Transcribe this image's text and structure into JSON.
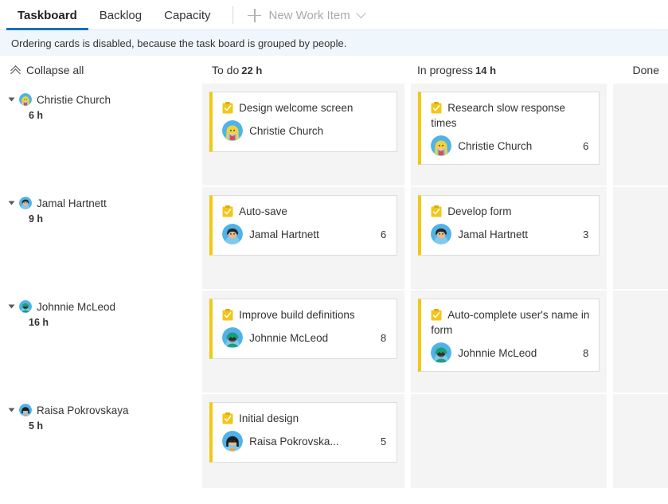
{
  "tabs": [
    {
      "label": "Taskboard",
      "active": true
    },
    {
      "label": "Backlog",
      "active": false
    },
    {
      "label": "Capacity",
      "active": false
    }
  ],
  "toolbar": {
    "new_work_item_label": "New Work Item",
    "plus_icon": "plus-icon",
    "chevron_icon": "chevron-down-icon"
  },
  "banner": {
    "message": "Ordering cards is disabled, because the task board is grouped by people."
  },
  "board": {
    "collapse_all_label": "Collapse all",
    "columns": [
      {
        "name": "To do",
        "hours": "22 h"
      },
      {
        "name": "In progress",
        "hours": "14 h"
      },
      {
        "name": "Done",
        "hours": ""
      }
    ],
    "rows": [
      {
        "person": "Christie Church",
        "hours": "6 h",
        "avatar": {
          "skin": "#f4c9a5",
          "hair": "#f2d23c",
          "bg": "#4fb3e8",
          "hairstyle": "long"
        },
        "todo": [
          {
            "title": "Design welcome screen",
            "assignee": "Christie Church",
            "remaining": ""
          }
        ],
        "inprogress": [
          {
            "title": "Research slow response times",
            "assignee": "Christie Church",
            "remaining": "6"
          }
        ],
        "done": []
      },
      {
        "person": "Jamal Hartnett",
        "hours": "9 h",
        "avatar": {
          "skin": "#e8b98c",
          "hair": "#23272e",
          "bg": "#4fb3e8",
          "hairstyle": "short"
        },
        "todo": [
          {
            "title": "Auto-save",
            "assignee": "Jamal Hartnett",
            "remaining": "6"
          }
        ],
        "inprogress": [
          {
            "title": "Develop form",
            "assignee": "Jamal Hartnett",
            "remaining": "3"
          }
        ],
        "done": []
      },
      {
        "person": "Johnnie McLeod",
        "hours": "16 h",
        "avatar": {
          "skin": "#6b4b36",
          "hair": "#1d9e74",
          "bg": "#4fb3e8",
          "hairstyle": "cap"
        },
        "todo": [
          {
            "title": "Improve build definitions",
            "assignee": "Johnnie McLeod",
            "remaining": "8"
          }
        ],
        "inprogress": [
          {
            "title": "Auto-complete user's name in form",
            "assignee": "Johnnie McLeod",
            "remaining": "8"
          }
        ],
        "done": []
      },
      {
        "person": "Raisa Pokrovskaya",
        "hours": "5 h",
        "avatar": {
          "skin": "#f0b878",
          "hair": "#1c1c1c",
          "bg": "#4fb3e8",
          "hairstyle": "bob"
        },
        "todo": [
          {
            "title": "Initial design",
            "assignee": "Raisa Pokrovska...",
            "remaining": "5"
          }
        ],
        "inprogress": [],
        "done": []
      }
    ]
  },
  "colors": {
    "accent": "#1b6fb5",
    "banner_bg": "#eff6fc",
    "card_accent": "#f2c811",
    "column_bg": "#f4f4f4"
  }
}
